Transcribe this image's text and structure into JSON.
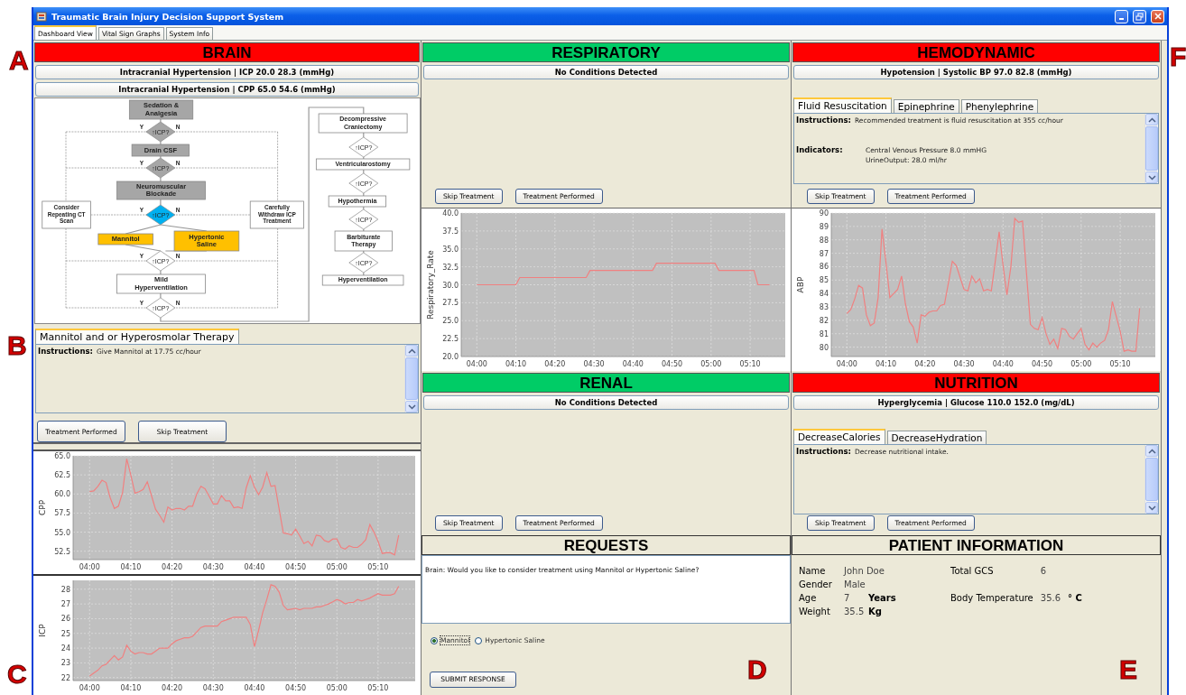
{
  "window": {
    "title": "Traumatic Brain Injury Decision Support System"
  },
  "tabs": [
    {
      "label": "Dashboard View",
      "selected": true
    },
    {
      "label": "Vital Sign Graphs",
      "selected": false
    },
    {
      "label": "System Info",
      "selected": false
    }
  ],
  "brain": {
    "title": "BRAIN",
    "color": "#ff0000",
    "conditions": [
      "Intracranial Hypertension | ICP 20.0 28.3 (mmHg)",
      "Intracranial Hypertension | CPP 65.0 54.6 (mmHg)"
    ],
    "flowchart": {
      "nodes": [
        {
          "kind": "process",
          "text": "Sedation & Analgesia",
          "color": "#a6a6a6"
        },
        {
          "kind": "decision",
          "text": "↑ICP?",
          "yes": "Y",
          "no": "N",
          "color": "#a6a6a6"
        },
        {
          "kind": "process",
          "text": "Drain CSF",
          "color": "#a6a6a6"
        },
        {
          "kind": "decision",
          "text": "↑ICP?",
          "yes": "Y",
          "no": "N",
          "color": "#a6a6a6"
        },
        {
          "kind": "process",
          "text": "Neuromuscular Blockade",
          "color": "#a6a6a6"
        },
        {
          "kind": "process",
          "text": "Consider Repeating CT Scan",
          "color": "#ffffff"
        },
        {
          "kind": "decision",
          "text": "↑ICP?",
          "yes": "Y",
          "no": "N",
          "color": "#00b0f0"
        },
        {
          "kind": "process",
          "text": "Carefully Withdraw ICP Treatment",
          "color": "#ffffff"
        },
        {
          "kind": "process",
          "text": "Mannitol",
          "color": "#ffc000"
        },
        {
          "kind": "process",
          "text": "Hypertonic Saline",
          "color": "#ffc000"
        },
        {
          "kind": "decision",
          "text": "↑ICP?",
          "yes": "Y",
          "no": "N",
          "color": "#ffffff"
        },
        {
          "kind": "process",
          "text": "Mild Hyperventilation",
          "color": "#ffffff"
        },
        {
          "kind": "decision",
          "text": "↑ICP?",
          "yes": "Y",
          "no": "N",
          "color": "#ffffff"
        },
        {
          "kind": "process",
          "text": "Decompressive Craniectomy",
          "color": "#ffffff"
        },
        {
          "kind": "decision",
          "text": "↑ICP?",
          "color": "#ffffff"
        },
        {
          "kind": "process",
          "text": "Ventricularostomy",
          "color": "#ffffff"
        },
        {
          "kind": "decision",
          "text": "↑ICP?",
          "color": "#ffffff"
        },
        {
          "kind": "process",
          "text": "Hypothermia",
          "color": "#ffffff"
        },
        {
          "kind": "decision",
          "text": "↑ICP?",
          "color": "#ffffff"
        },
        {
          "kind": "process",
          "text": "Barbiturate Therapy",
          "color": "#ffffff"
        },
        {
          "kind": "decision",
          "text": "↑ICP?",
          "color": "#ffffff"
        },
        {
          "kind": "process",
          "text": "Hyperventilation",
          "color": "#ffffff"
        }
      ]
    },
    "treatment_tabs": [
      {
        "label": "Mannitol and or Hyperosmolar Therapy",
        "selected": true
      }
    ],
    "instructions_label": "Instructions:",
    "instructions": "Give Mannitol at 17.75 cc/hour",
    "buttons": [
      "Treatment Performed",
      "Skip Treatment"
    ],
    "cpp_graph": {
      "chart_data": {
        "type": "line",
        "grid": true,
        "ylabel": "CPP",
        "ylim": [
          51.4,
          65
        ],
        "yticks": [
          {
            "value": 52.5,
            "label": "52.5"
          },
          {
            "value": 55,
            "label": "55.0"
          },
          {
            "value": 57.5,
            "label": "57.5"
          },
          {
            "value": 60,
            "label": "60.0"
          },
          {
            "value": 62.5,
            "label": "62.5"
          },
          {
            "value": 65,
            "label": "65.0"
          }
        ],
        "categories": [
          "04:00",
          null,
          null,
          null,
          null,
          null,
          null,
          null,
          null,
          null,
          "04:10",
          null,
          null,
          null,
          null,
          null,
          null,
          null,
          null,
          null,
          "04:20",
          null,
          null,
          null,
          null,
          null,
          null,
          null,
          null,
          null,
          "04:30",
          null,
          null,
          null,
          null,
          null,
          null,
          null,
          null,
          null,
          "04:40",
          null,
          null,
          null,
          null,
          null,
          null,
          null,
          null,
          null,
          "04:50",
          null,
          null,
          null,
          null,
          null,
          null,
          null,
          null,
          null,
          "05:00",
          null,
          null,
          null,
          null,
          null,
          null,
          null,
          null,
          null,
          "05:10",
          null,
          null,
          null,
          null,
          null
        ],
        "series": [
          {
            "color": "#f08080",
            "values": [
              60.3,
              60.4,
              61,
              61.8,
              61.5,
              59.5,
              58.1,
              58.4,
              60.2,
              64.6,
              62.5,
              60.1,
              60.3,
              60.6,
              61.6,
              59.8,
              58,
              57.2,
              56.3,
              58.3,
              57.9,
              58.1,
              58.1,
              57.9,
              58.4,
              58.4,
              60,
              61,
              60.7,
              59.7,
              58.7,
              58.7,
              59.8,
              59.1,
              59.1,
              58.2,
              58.3,
              58.1,
              60.8,
              62.4,
              60.9,
              59.9,
              60.9,
              62.8,
              61,
              61.1,
              58,
              54.9,
              54.8,
              54.6,
              55.4,
              54.5,
              53.5,
              53.8,
              53.2,
              54.6,
              54.5,
              53.9,
              53.7,
              54.1,
              54.1,
              53,
              52.8,
              53.2,
              53,
              53,
              53.4,
              54,
              56,
              55,
              53.8,
              52.2,
              52.3,
              52.3,
              52,
              54.6
            ]
          }
        ]
      }
    },
    "icp_graph": {
      "chart_data": {
        "type": "line",
        "grid": true,
        "ylabel": "ICP",
        "ylim": [
          21.8,
          28.6
        ],
        "yticks": [
          22,
          23,
          24,
          25,
          26,
          27,
          28
        ],
        "categories": [
          "04:00",
          null,
          null,
          null,
          null,
          null,
          null,
          null,
          null,
          null,
          "04:10",
          null,
          null,
          null,
          null,
          null,
          null,
          null,
          null,
          null,
          "04:20",
          null,
          null,
          null,
          null,
          null,
          null,
          null,
          null,
          null,
          "04:30",
          null,
          null,
          null,
          null,
          null,
          null,
          null,
          null,
          null,
          "04:40",
          null,
          null,
          null,
          null,
          null,
          null,
          null,
          null,
          null,
          "04:50",
          null,
          null,
          null,
          null,
          null,
          null,
          null,
          null,
          null,
          "05:00",
          null,
          null,
          null,
          null,
          null,
          null,
          null,
          null,
          null,
          "05:10",
          null,
          null,
          null,
          null,
          null
        ],
        "series": [
          {
            "color": "#f08080",
            "values": [
              22.1,
              22.3,
              22.5,
              22.8,
              22.9,
              23.2,
              23.5,
              23.2,
              23.4,
              24.2,
              23.8,
              23.6,
              23.7,
              23.7,
              23.6,
              23.6,
              23.8,
              24,
              24,
              24,
              24.3,
              24.5,
              24.6,
              24.7,
              24.7,
              24.8,
              25.1,
              25.4,
              25.5,
              25.5,
              25.5,
              25.5,
              25.8,
              25.9,
              26,
              26.1,
              26.1,
              26.1,
              26.1,
              25.6,
              24.1,
              25.2,
              26.4,
              27.3,
              28.3,
              28.2,
              27.8,
              26.9,
              26.6,
              26.65,
              26.7,
              26.6,
              26.7,
              26.7,
              26.7,
              26.8,
              26.8,
              26.9,
              27,
              27.15,
              27.3,
              27.2,
              27,
              27.1,
              27.1,
              27.3,
              27.2,
              27.3,
              27.4,
              27.55,
              27.7,
              27.6,
              27.6,
              27.6,
              27.7,
              28.2
            ]
          }
        ]
      }
    }
  },
  "respiratory": {
    "title": "RESPIRATORY",
    "color": "#00cc66",
    "conditions": [
      "No Conditions Detected"
    ],
    "buttons": [
      "Skip Treatment",
      "Treatment Performed"
    ],
    "chart_data": {
      "type": "line",
      "grid": true,
      "ylabel": "Respiratory_Rate",
      "ylim": [
        20,
        40
      ],
      "yticks": [
        {
          "value": 20,
          "label": "20.0"
        },
        {
          "value": 22.5,
          "label": "22.5"
        },
        {
          "value": 25,
          "label": "25.0"
        },
        {
          "value": 27.5,
          "label": "27.5"
        },
        {
          "value": 30,
          "label": "30.0"
        },
        {
          "value": 32.5,
          "label": "32.5"
        },
        {
          "value": 35,
          "label": "35.0"
        },
        {
          "value": 37.5,
          "label": "37.5"
        },
        {
          "value": 40,
          "label": "40.0"
        }
      ],
      "categories": [
        "04:00",
        null,
        null,
        null,
        null,
        null,
        null,
        null,
        null,
        null,
        "04:10",
        null,
        null,
        null,
        null,
        null,
        null,
        null,
        null,
        null,
        "04:20",
        null,
        null,
        null,
        null,
        null,
        null,
        null,
        null,
        null,
        "04:30",
        null,
        null,
        null,
        null,
        null,
        null,
        null,
        null,
        null,
        "04:40",
        null,
        null,
        null,
        null,
        null,
        null,
        null,
        null,
        null,
        "04:50",
        null,
        null,
        null,
        null,
        null,
        null,
        null,
        null,
        null,
        "05:00",
        null,
        null,
        null,
        null,
        null,
        null,
        null,
        null,
        null,
        "05:10",
        null,
        null,
        null,
        null,
        null
      ],
      "series": [
        {
          "color": "#f08080",
          "values": [
            30,
            30,
            30,
            30,
            30,
            30,
            30,
            30,
            30,
            30,
            30,
            31,
            31,
            31,
            31,
            31,
            31,
            31,
            31,
            31,
            31,
            31,
            31,
            31,
            31,
            31,
            31,
            31,
            31,
            32,
            32,
            32,
            32,
            32,
            32,
            32,
            32,
            32,
            32,
            32,
            32,
            32,
            32,
            32,
            32,
            32,
            33,
            33,
            33,
            33,
            33,
            33,
            33,
            33,
            33,
            33,
            33,
            33,
            33,
            33,
            33,
            33,
            32,
            32,
            32,
            32,
            32,
            32,
            32,
            32,
            32,
            32,
            30,
            30,
            30,
            30
          ]
        }
      ]
    }
  },
  "hemodynamic": {
    "title": "HEMODYNAMIC",
    "color": "#ff0000",
    "conditions": [
      "Hypotension | Systolic BP 97.0 82.8 (mmHg)"
    ],
    "treatment_tabs": [
      {
        "label": "Fluid Resuscitation",
        "selected": true
      },
      {
        "label": "Epinephrine",
        "selected": false
      },
      {
        "label": "Phenylephrine",
        "selected": false
      }
    ],
    "instructions_label": "Instructions:",
    "instructions": "Recommended treatment is fluid resuscitation at 355 cc/hour",
    "indicators_label": "Indicators:",
    "indicators": [
      "Central Venous Pressure 8.0 mmHG",
      "UrineOutput:  28.0 ml/hr"
    ],
    "buttons": [
      "Skip Treatment",
      "Treatment Performed"
    ],
    "chart_data": {
      "type": "line",
      "grid": true,
      "ylabel": "ABP",
      "ylim": [
        79.3,
        90
      ],
      "yticks": [
        80,
        81,
        82,
        83,
        84,
        85,
        86,
        87,
        88,
        89,
        90
      ],
      "categories": [
        "04:00",
        null,
        null,
        null,
        null,
        null,
        null,
        null,
        null,
        null,
        "04:10",
        null,
        null,
        null,
        null,
        null,
        null,
        null,
        null,
        null,
        "04:20",
        null,
        null,
        null,
        null,
        null,
        null,
        null,
        null,
        null,
        "04:30",
        null,
        null,
        null,
        null,
        null,
        null,
        null,
        null,
        null,
        "04:40",
        null,
        null,
        null,
        null,
        null,
        null,
        null,
        null,
        null,
        "04:50",
        null,
        null,
        null,
        null,
        null,
        null,
        null,
        null,
        null,
        "05:00",
        null,
        null,
        null,
        null,
        null,
        null,
        null,
        null,
        null,
        "05:10",
        null,
        null,
        null,
        null,
        null
      ],
      "series": [
        {
          "color": "#f08080",
          "values": [
            82.5,
            82.8,
            83.6,
            84.6,
            84.4,
            82.4,
            81.6,
            81.8,
            83.7,
            88.8,
            86.3,
            83.7,
            84,
            84.3,
            85.3,
            83.2,
            81.9,
            81.5,
            80.3,
            82.4,
            82.3,
            82.6,
            82.7,
            82.7,
            83.1,
            83.2,
            84.8,
            86.4,
            86.1,
            85.2,
            84.3,
            84.2,
            85.3,
            84.8,
            85.1,
            84.2,
            84.3,
            84.2,
            86.4,
            88.6,
            86.1,
            83.9,
            86,
            89.6,
            89.3,
            89.4,
            85.5,
            81.7,
            81.4,
            81.3,
            82.2,
            81,
            80.2,
            80.6,
            79.9,
            81.4,
            81.3,
            80.8,
            80.6,
            81,
            81.4,
            80.2,
            79.8,
            80.3,
            80,
            80.3,
            80.5,
            81.3,
            83.4,
            82.3,
            81.2,
            79.7,
            79.8,
            79.7,
            79.7,
            82.9
          ]
        }
      ]
    }
  },
  "renal": {
    "title": "RENAL",
    "color": "#00cc66",
    "conditions": [
      "No Conditions Detected"
    ],
    "buttons": [
      "Skip Treatment",
      "Treatment Performed"
    ]
  },
  "nutrition": {
    "title": "NUTRITION",
    "color": "#ff0000",
    "conditions": [
      "Hyperglycemia | Glucose 110.0 152.0 (mg/dL)"
    ],
    "treatment_tabs": [
      {
        "label": "DecreaseCalories",
        "selected": true
      },
      {
        "label": "DecreaseHydration",
        "selected": false
      }
    ],
    "instructions_label": "Instructions:",
    "instructions": "Decrease nutritional intake.",
    "buttons": [
      "Skip Treatment",
      "Treatment Performed"
    ]
  },
  "requests": {
    "title": "REQUESTS",
    "message": "Brain: Would you like to consider treatment using Mannitol or Hypertonic Saline?",
    "options": [
      {
        "label": "Mannitol",
        "selected": true
      },
      {
        "label": "Hypertonic Saline",
        "selected": false
      }
    ],
    "submit": "SUBMIT RESPONSE"
  },
  "patient_information": {
    "title": "PATIENT INFORMATION",
    "fields": [
      {
        "label": "Name",
        "value": "John Doe"
      },
      {
        "label": "Gender",
        "value": "Male"
      },
      {
        "label": "Age",
        "value": "7",
        "unit": "Years"
      },
      {
        "label": "Weight",
        "value": "35.5",
        "unit": "Kg"
      }
    ],
    "right_fields": [
      {
        "label": "Total GCS",
        "value": "6"
      },
      {
        "label": "Body Temperature",
        "value": "35.6",
        "unit": "° C"
      }
    ]
  },
  "annotations": [
    {
      "label": "A"
    },
    {
      "label": "B"
    },
    {
      "label": "C"
    },
    {
      "label": "D"
    },
    {
      "label": "E"
    },
    {
      "label": "F"
    }
  ]
}
